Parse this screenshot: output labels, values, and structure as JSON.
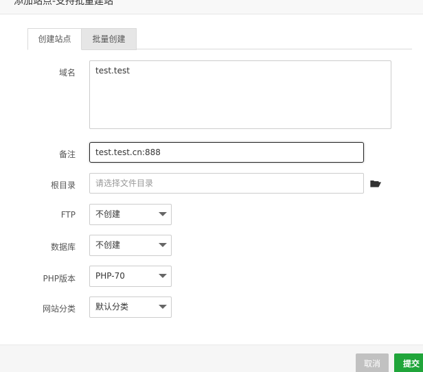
{
  "dialog": {
    "title": "添加站点-支持批量建站"
  },
  "tabs": [
    {
      "label": "创建站点",
      "active": true
    },
    {
      "label": "批量创建",
      "active": false
    }
  ],
  "form": {
    "domain": {
      "label": "域名",
      "value": "test.test"
    },
    "remark": {
      "label": "备注",
      "value": "test.test.cn:888"
    },
    "root_dir": {
      "label": "根目录",
      "placeholder": "请选择文件目录",
      "icon": "folder-open-icon"
    },
    "ftp": {
      "label": "FTP",
      "selected": "不创建"
    },
    "database": {
      "label": "数据库",
      "selected": "不创建"
    },
    "php_version": {
      "label": "PHP版本",
      "selected": "PHP-70"
    },
    "site_category": {
      "label": "网站分类",
      "selected": "默认分类"
    }
  },
  "footer": {
    "cancel_label": "取消",
    "submit_label": "提交"
  },
  "colors": {
    "submit": "#20a53a",
    "cancel": "#c1c1c1",
    "focus_border": "#222222"
  }
}
